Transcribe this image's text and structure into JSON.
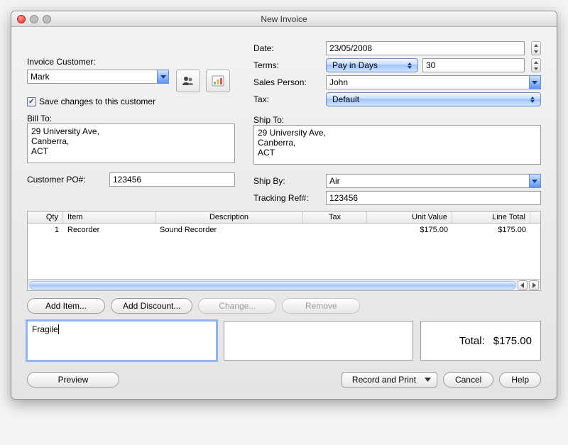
{
  "window": {
    "title": "New Invoice"
  },
  "left": {
    "invoice_customer_label": "Invoice Customer:",
    "customer_value": "Mark",
    "save_changes_label": "Save changes to this customer",
    "save_changes_checked": true,
    "bill_to_label": "Bill To:",
    "bill_to_text": "29 University Ave,\nCanberra,\nACT",
    "customer_po_label": "Customer PO#:",
    "customer_po_value": "123456"
  },
  "right": {
    "date_label": "Date:",
    "date_value": "23/05/2008",
    "terms_label": "Terms:",
    "terms_value": "Pay in Days",
    "terms_days_value": "30",
    "sales_person_label": "Sales Person:",
    "sales_person_value": "John",
    "tax_label": "Tax:",
    "tax_value": "Default",
    "ship_to_label": "Ship To:",
    "ship_to_text": "29 University Ave,\nCanberra,\nACT",
    "ship_by_label": "Ship By:",
    "ship_by_value": "Air",
    "tracking_label": "Tracking Ref#:",
    "tracking_value": "123456"
  },
  "table": {
    "headers": {
      "qty": "Qty",
      "item": "Item",
      "description": "Description",
      "tax": "Tax",
      "unit_value": "Unit Value",
      "line_total": "Line Total"
    },
    "rows": [
      {
        "qty": "1",
        "item": "Recorder",
        "description": "Sound Recorder",
        "tax": "",
        "unit_value": "$175.00",
        "line_total": "$175.00"
      }
    ]
  },
  "buttons": {
    "add_item": "Add Item...",
    "add_discount": "Add Discount...",
    "change": "Change...",
    "remove": "Remove",
    "preview": "Preview",
    "record_and_print": "Record and Print",
    "cancel": "Cancel",
    "help": "Help"
  },
  "notes": {
    "left": "Fragile",
    "right": ""
  },
  "total": {
    "label": "Total:",
    "value": "$175.00"
  },
  "icons": {
    "people": "people-icon",
    "chart": "chart-icon"
  }
}
